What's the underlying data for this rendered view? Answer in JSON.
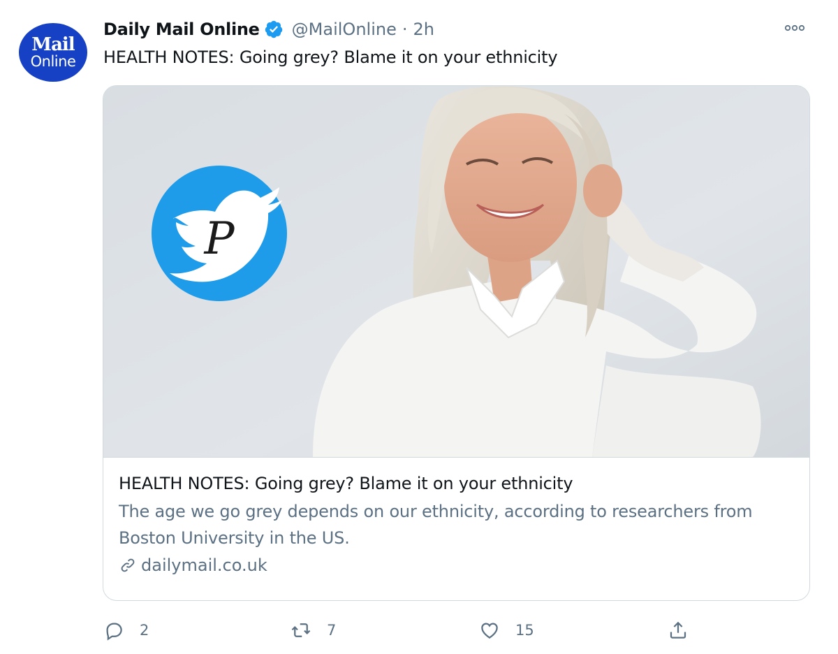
{
  "tweet": {
    "avatar": {
      "line1": "Mail",
      "line2": "Online"
    },
    "display_name": "Daily Mail Online",
    "handle": "@MailOnline",
    "separator": "·",
    "time": "2h",
    "text": "HEALTH NOTES: Going grey? Blame it on your ethnicity"
  },
  "card": {
    "image_icon": "twitter-bird-p-badge-icon",
    "title": "HEALTH NOTES: Going grey? Blame it on your ethnicity",
    "description": "The age we go grey depends on our ethnicity, according to researchers from Boston University in the US.",
    "domain": "dailymail.co.uk"
  },
  "actions": {
    "reply_count": "2",
    "retweet_count": "7",
    "like_count": "15"
  },
  "colors": {
    "avatar_bg": "#1641c4",
    "verified": "#1d9bf0",
    "badge_blue": "#1e9be9",
    "secondary_text": "#5b7083"
  }
}
